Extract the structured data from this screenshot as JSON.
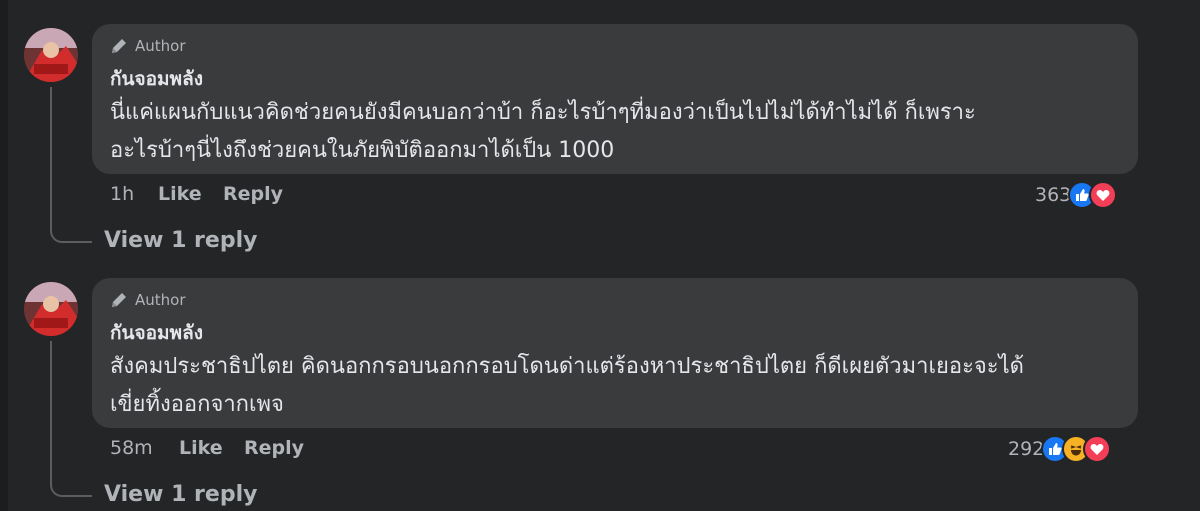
{
  "comments": [
    {
      "author_badge": "Author",
      "name": "กันจอมพลัง",
      "text_line1": "นี่แค่แผนกับแนวคิดช่วยคนยังมีคนบอกว่าบ้า ก็อะไรบ้าๆที่มองว่าเป็นไปไม่ได้ทำไม่ได้ ก็เพราะ",
      "text_line2": "อะไรบ้าๆนี่ไงถึงช่วยคนในภัยพิบัติออกมาได้เป็น 1000",
      "time": "1h",
      "like_label": "Like",
      "reply_label": "Reply",
      "reaction_count": "363",
      "reactions": [
        "like-icon",
        "love-icon"
      ],
      "view_replies": "View 1 reply"
    },
    {
      "author_badge": "Author",
      "name": "กันจอมพลัง",
      "text_line1": "สังคมประชาธิปไตย คิดนอกกรอบนอกกรอบโดนด่าแต่ร้องหาประชาธิปไตย ก็ดีเผยตัวมาเยอะจะได้",
      "text_line2": "เขี่ยทิ้งออกจากเพจ",
      "time": "58m",
      "like_label": "Like",
      "reply_label": "Reply",
      "reaction_count": "292",
      "reactions": [
        "like-icon",
        "haha-icon",
        "love-icon"
      ],
      "view_replies": "View 1 reply"
    }
  ],
  "colors": {
    "background": "#242526",
    "bubble": "#3a3b3c",
    "text": "#e4e6eb",
    "muted": "#b0b3b8",
    "like": "#1877f2",
    "love": "#f33e58",
    "haha": "#f7b125"
  }
}
